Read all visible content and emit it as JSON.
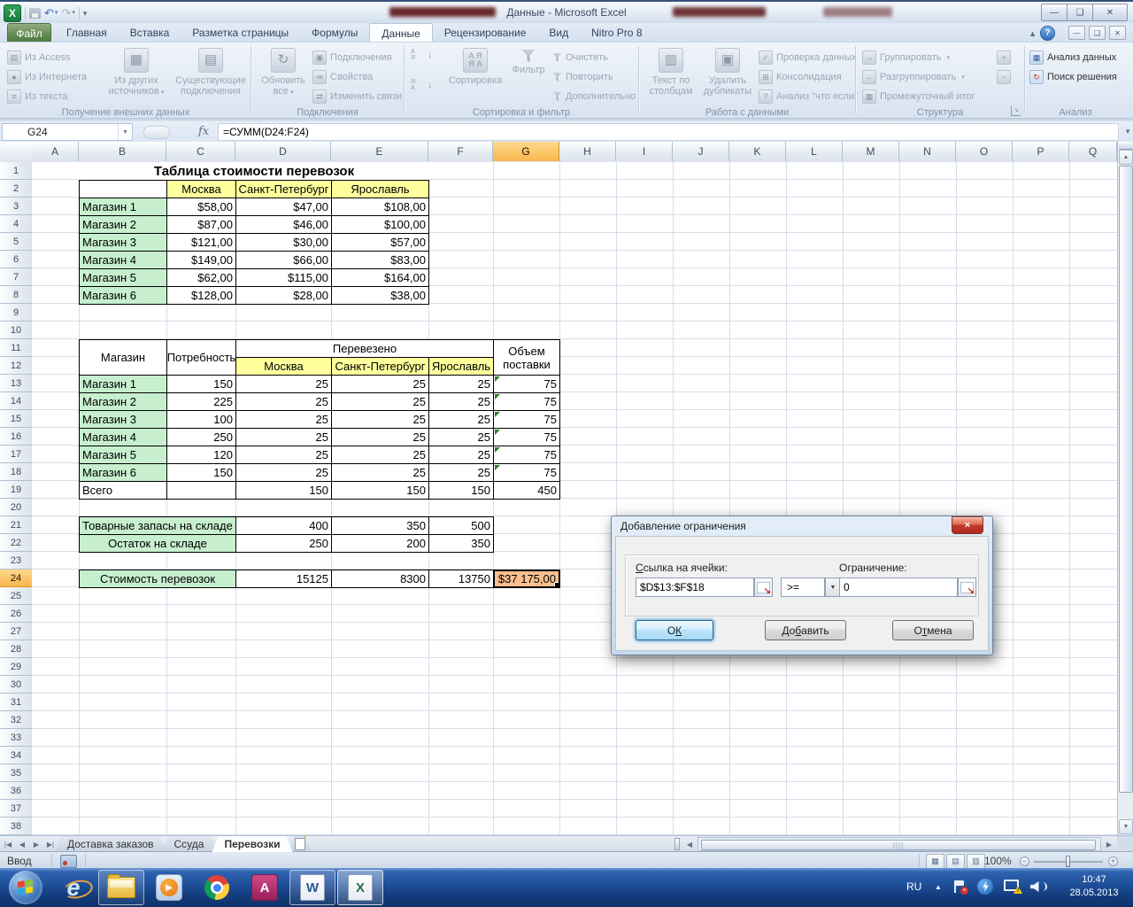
{
  "titlebar": {
    "title": "Данные  -  Microsoft Excel"
  },
  "tabs": {
    "file": "Файл",
    "items": [
      "Главная",
      "Вставка",
      "Разметка страницы",
      "Формулы",
      "Данные",
      "Рецензирование",
      "Вид",
      "Nitro Pro 8"
    ],
    "active": "Данные"
  },
  "ribbon": {
    "groups": [
      {
        "label": "Получение внешних данных",
        "items": [
          "Из Access",
          "Из Интернета",
          "Из текста",
          "Из других источников",
          "Существующие подключения"
        ]
      },
      {
        "label": "Подключения",
        "items": [
          "Обновить все",
          "Подключения",
          "Свойства",
          "Изменить связи"
        ]
      },
      {
        "label": "Сортировка и фильтр",
        "items": [
          "Сортировка",
          "Фильтр",
          "Очистить",
          "Повторить",
          "Дополнительно"
        ]
      },
      {
        "label": "Работа с данными",
        "items": [
          "Текст по столбцам",
          "Удалить дубликаты",
          "Проверка данных",
          "Консолидация",
          "Анализ \"что если\""
        ]
      },
      {
        "label": "Структура",
        "items": [
          "Группировать",
          "Разгруппировать",
          "Промежуточный итог"
        ]
      },
      {
        "label": "Анализ",
        "items": [
          "Анализ данных",
          "Поиск решения"
        ]
      }
    ]
  },
  "formula_bar": {
    "name_box": "G24",
    "fx_label": "fx",
    "formula": "=СУММ(D24:F24)"
  },
  "sheet": {
    "columns": [
      "A",
      "B",
      "C",
      "D",
      "E",
      "F",
      "G",
      "H",
      "I",
      "J",
      "K",
      "L",
      "M",
      "N",
      "O",
      "P",
      "Q"
    ],
    "selected_column": "G",
    "selected_row": 24,
    "num_rows": 38,
    "tables": {
      "costs": {
        "title": "Таблица стоимости перевозок",
        "columns": [
          "Москва",
          "Санкт-Петербург",
          "Ярославль"
        ],
        "rows": [
          [
            "Магазин 1",
            "$58,00",
            "$47,00",
            "$108,00"
          ],
          [
            "Магазин 2",
            "$87,00",
            "$46,00",
            "$100,00"
          ],
          [
            "Магазин 3",
            "$121,00",
            "$30,00",
            "$57,00"
          ],
          [
            "Магазин 4",
            "$149,00",
            "$66,00",
            "$83,00"
          ],
          [
            "Магазин 5",
            "$62,00",
            "$115,00",
            "$164,00"
          ],
          [
            "Магазин 6",
            "$128,00",
            "$28,00",
            "$38,00"
          ]
        ]
      },
      "transport": {
        "store_header": "Магазин",
        "need_header": "Потребность",
        "moved_header": "Перевезено",
        "volume_header": "Объем поставки",
        "columns": [
          "Москва",
          "Санкт-Петербург",
          "Ярославль"
        ],
        "rows": [
          [
            "Магазин 1",
            "150",
            "25",
            "25",
            "25",
            "75"
          ],
          [
            "Магазин 2",
            "225",
            "25",
            "25",
            "25",
            "75"
          ],
          [
            "Магазин 3",
            "100",
            "25",
            "25",
            "25",
            "75"
          ],
          [
            "Магазин 4",
            "250",
            "25",
            "25",
            "25",
            "75"
          ],
          [
            "Магазин 5",
            "120",
            "25",
            "25",
            "25",
            "75"
          ],
          [
            "Магазин 6",
            "150",
            "25",
            "25",
            "25",
            "75"
          ]
        ],
        "total_row": [
          "Всего",
          "",
          "150",
          "150",
          "150",
          "450"
        ]
      },
      "stock": {
        "rows": [
          [
            "Товарные запасы на складе",
            "400",
            "350",
            "500"
          ],
          [
            "Остаток на складе",
            "250",
            "200",
            "350"
          ]
        ]
      },
      "cost": {
        "label": "Стоимость перевозок",
        "values": [
          "15125",
          "8300",
          "13750"
        ],
        "total": "$37 175,00"
      }
    }
  },
  "dialog": {
    "title": "Добавление ограничения",
    "ref_label_key": "С",
    "ref_label_rest": "сылка на ячейки:",
    "ref_value": "$D$13:$F$18",
    "operator": ">=",
    "limit_label": "Ограничение:",
    "limit_value": "0",
    "ok_pre": "О",
    "ok_key": "К",
    "ok_post": "",
    "add_pre": "До",
    "add_key": "б",
    "add_post": "авить",
    "cancel_pre": "О",
    "cancel_key": "т",
    "cancel_post": "мена"
  },
  "sheet_tabs": {
    "items": [
      "Доставка заказов",
      "Ссуда",
      "Перевозки"
    ],
    "active": "Перевозки"
  },
  "status_bar": {
    "mode": "Ввод",
    "zoom_level": "100%"
  },
  "tray": {
    "lang": "RU",
    "time": "10:47",
    "date": "28.05.2013"
  }
}
